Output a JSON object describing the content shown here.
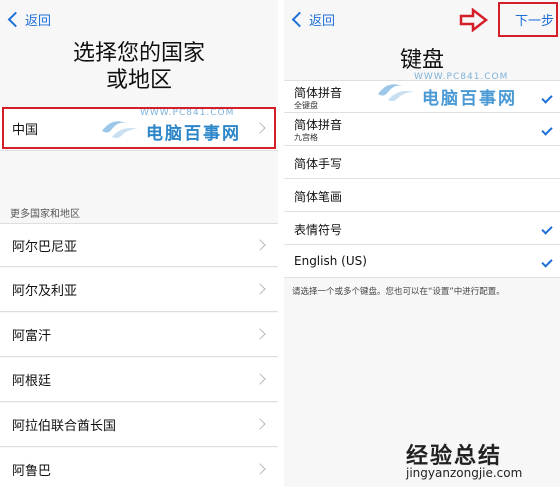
{
  "left": {
    "back_label": "返回",
    "title_line1": "选择您的国家",
    "title_line2": "或地区",
    "selected_country": "中国",
    "section_header": "更多国家和地区",
    "countries": [
      "阿尔巴尼亚",
      "阿尔及利亚",
      "阿富汗",
      "阿根廷",
      "阿拉伯联合酋长国",
      "阿鲁巴"
    ]
  },
  "right": {
    "back_label": "返回",
    "next_label": "下一步",
    "title": "键盘",
    "keyboards": [
      {
        "label": "简体拼音",
        "sub": "全键盘",
        "checked": true
      },
      {
        "label": "简体拼音",
        "sub": "九宫格",
        "checked": true
      },
      {
        "label": "简体手写",
        "sub": "",
        "checked": false
      },
      {
        "label": "简体笔画",
        "sub": "",
        "checked": false
      },
      {
        "label": "表情符号",
        "sub": "",
        "checked": true
      },
      {
        "label": "English (US)",
        "sub": "",
        "checked": true
      }
    ],
    "note": "请选择一个或多个键盘。您也可以在“设置”中进行配置。"
  },
  "watermarks": {
    "url": "WWW.PC841.COM",
    "name": "电脑百事网",
    "corner_line1": "经验总结",
    "corner_line2": "jingyanzongjie.com"
  },
  "colors": {
    "accent": "#1f6fd9",
    "highlight": "#d41f2b",
    "watermark": "#2c86c9"
  }
}
